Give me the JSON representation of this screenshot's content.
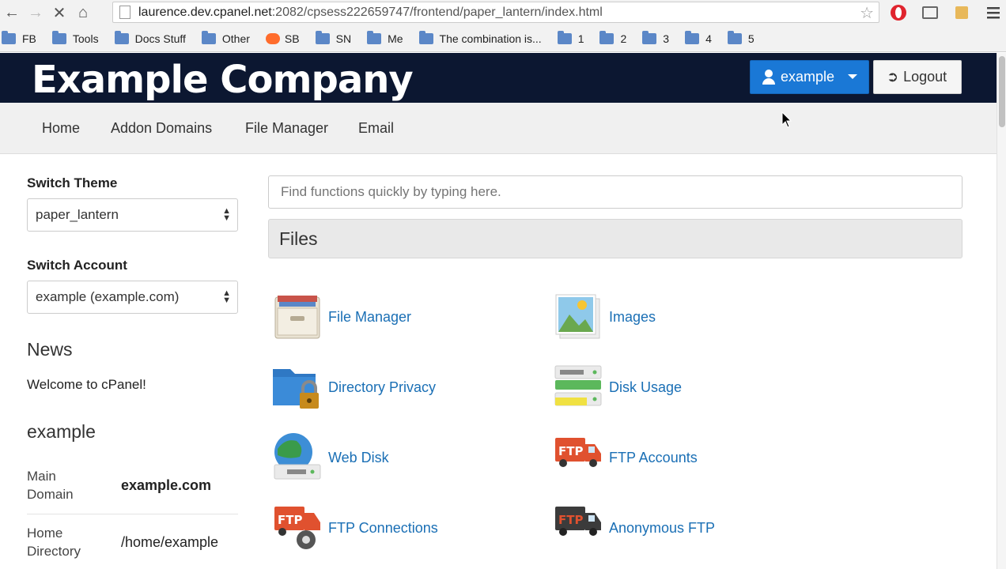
{
  "browser": {
    "url_host": "laurence.dev.cpanel.net",
    "url_rest": ":2082/cpsess222659747/frontend/paper_lantern/index.html",
    "bookmarks": [
      "FB",
      "Tools",
      "Docs Stuff",
      "Other",
      "SB",
      "SN",
      "Me",
      "The combination is...",
      "1",
      "2",
      "3",
      "4",
      "5"
    ]
  },
  "header": {
    "company": "Example Company",
    "user_button": "example",
    "logout_button": "Logout"
  },
  "nav": [
    "Home",
    "Addon Domains",
    "File Manager",
    "Email"
  ],
  "sidebar": {
    "switch_theme_label": "Switch Theme",
    "theme_value": "paper_lantern",
    "switch_account_label": "Switch Account",
    "account_value": "example (example.com)",
    "news_heading": "News",
    "news_text": "Welcome to cPanel!",
    "account_heading": "example",
    "stats": [
      {
        "key": "Main Domain",
        "value": "example.com"
      },
      {
        "key": "Home Directory",
        "value": "/home/example"
      }
    ]
  },
  "main": {
    "search_placeholder": "Find functions quickly by typing here.",
    "section_title": "Files",
    "items": [
      {
        "label": "File Manager",
        "icon": "file-manager-icon"
      },
      {
        "label": "Images",
        "icon": "images-icon"
      },
      {
        "label": "Directory Privacy",
        "icon": "directory-privacy-icon"
      },
      {
        "label": "Disk Usage",
        "icon": "disk-usage-icon"
      },
      {
        "label": "Web Disk",
        "icon": "web-disk-icon"
      },
      {
        "label": "FTP Accounts",
        "icon": "ftp-accounts-icon"
      },
      {
        "label": "FTP Connections",
        "icon": "ftp-connections-icon"
      },
      {
        "label": "Anonymous FTP",
        "icon": "anonymous-ftp-icon"
      }
    ]
  },
  "colors": {
    "brand_bar": "#0c1731",
    "primary_button": "#1a78d6",
    "link": "#1a6fb5"
  }
}
